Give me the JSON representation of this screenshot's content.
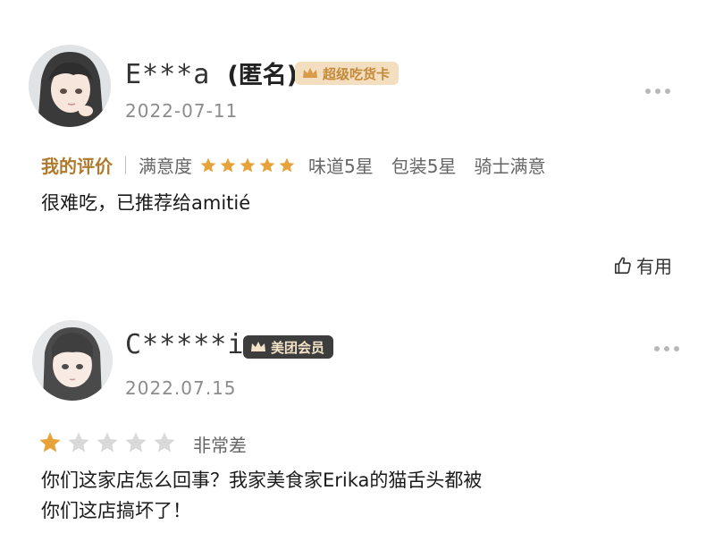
{
  "reviews": [
    {
      "username": "E***a",
      "anonymous_tag": "(匿名)",
      "badge": "超级吃货卡",
      "date": "2022-07-11",
      "my_review_label": "我的评价",
      "satisfaction_label": "满意度",
      "star_rating": 5,
      "taste": "味道5星",
      "packaging": "包装5星",
      "rider": "骑士满意",
      "content": "很难吃，已推荐给amitié",
      "useful_label": "有用"
    },
    {
      "username": "C*****i",
      "badge": "美团会员",
      "date": "2022.07.15",
      "star_rating": 1,
      "rating_text": "非常差",
      "content_line1": "你们这家店怎么回事？我家美食家Erika的猫舌头都被",
      "content_line2": "你们这店搞坏了！"
    }
  ],
  "colors": {
    "star_gold": "#e8a23a",
    "star_gray": "#d9d9d9",
    "badge_gold_bg": "#f3dfc0",
    "badge_dark_bg": "#3d3d3d",
    "my_review_label": "#b07a2d"
  },
  "icons": [
    "avatar-anime-girl",
    "crown-icon",
    "star-icon",
    "more-dots-icon",
    "thumbs-up-icon"
  ]
}
